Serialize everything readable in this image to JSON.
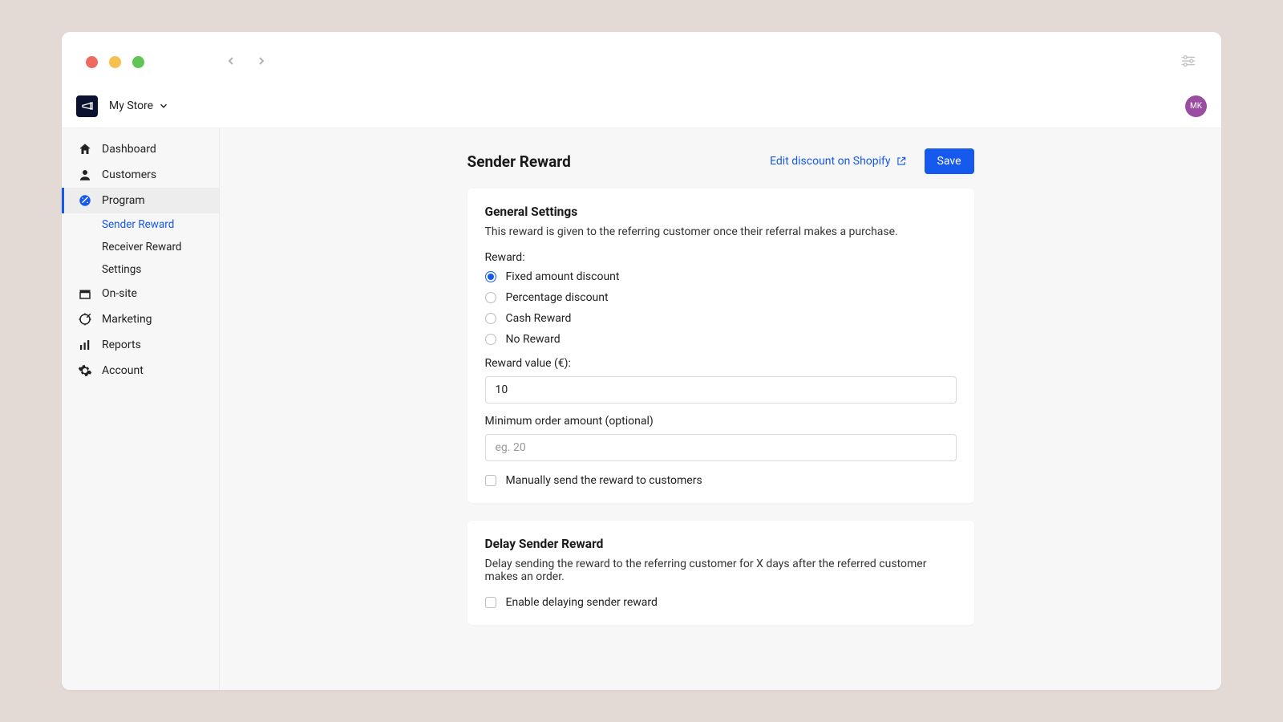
{
  "store_name": "My Store",
  "avatar_initials": "MK",
  "sidebar": {
    "items": [
      {
        "label": "Dashboard"
      },
      {
        "label": "Customers"
      },
      {
        "label": "Program"
      },
      {
        "label": "On-site"
      },
      {
        "label": "Marketing"
      },
      {
        "label": "Reports"
      },
      {
        "label": "Account"
      }
    ],
    "subitems": [
      {
        "label": "Sender Reward"
      },
      {
        "label": "Receiver Reward"
      },
      {
        "label": "Settings"
      }
    ]
  },
  "page": {
    "title": "Sender Reward",
    "edit_link": "Edit discount on Shopify",
    "save_label": "Save"
  },
  "general": {
    "heading": "General Settings",
    "desc": "This reward is given to the referring customer once their referral makes a purchase.",
    "reward_label": "Reward:",
    "options": [
      "Fixed amount discount",
      "Percentage discount",
      "Cash Reward",
      "No Reward"
    ],
    "reward_value_label": "Reward value (€):",
    "reward_value": "10",
    "min_order_label": "Minimum order amount (optional)",
    "min_order_placeholder": "eg. 20",
    "manual_send_label": "Manually send the reward to customers"
  },
  "delay": {
    "heading": "Delay Sender Reward",
    "desc": "Delay sending the reward to the referring customer for X days after the referred customer makes an order.",
    "enable_label": "Enable delaying sender reward"
  }
}
